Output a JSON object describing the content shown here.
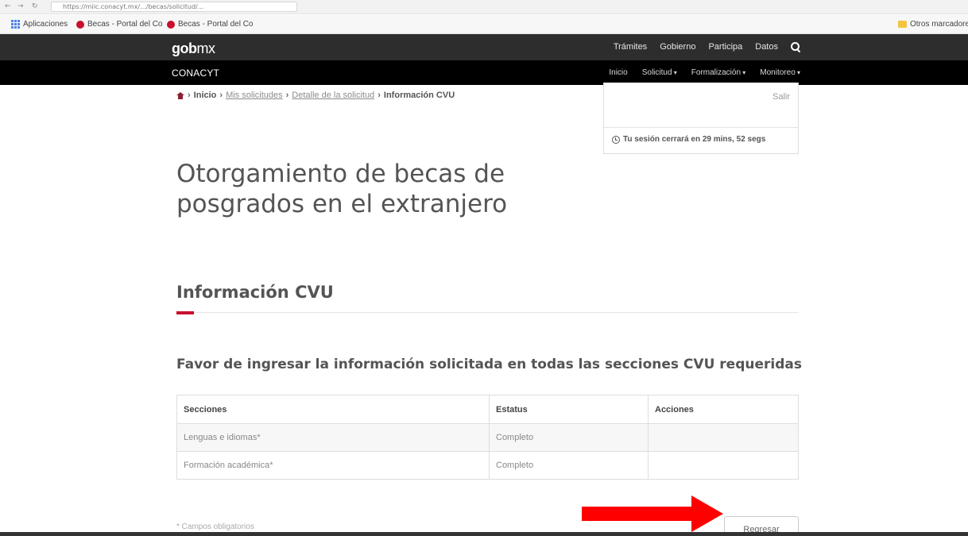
{
  "browser": {
    "url": "https://miic.conacyt.mx/.../becas/solicitud/...",
    "bookmarks": [
      {
        "label": "Aplicaciones",
        "icon": "apps-icon"
      },
      {
        "label": "Becas - Portal del Co",
        "icon": "conacyt-favicon"
      },
      {
        "label": "Becas - Portal del Co",
        "icon": "conacyt-favicon"
      }
    ],
    "other_bookmarks": "Otros marcadores"
  },
  "gob_header": {
    "logo_gob": "gob",
    "logo_mx": "mx",
    "links": [
      "Trámites",
      "Gobierno",
      "Participa",
      "Datos"
    ]
  },
  "conacyt_header": {
    "title": "CONACYT",
    "links": [
      "Inicio",
      "Solicitud",
      "Formalización",
      "Monitoreo"
    ]
  },
  "breadcrumb": {
    "items": [
      "Inicio",
      "Mis solicitudes",
      "Detalle de la solicitud",
      "Información CVU"
    ]
  },
  "session": {
    "logout": "Salir",
    "message": "Tu sesión cerrará en 29 mins, 52 segs"
  },
  "page": {
    "title": "Otorgamiento de becas de posgrados en el extranjero",
    "section_title": "Información CVU",
    "subtitle": "Favor de ingresar la información solicitada en todas las secciones CVU requeridas",
    "required_note": "* Campos obligatorios",
    "back_button": "Regresar"
  },
  "table": {
    "headers": [
      "Secciones",
      "Estatus",
      "Acciones"
    ],
    "rows": [
      [
        "Lenguas e idiomas*",
        "Completo",
        ""
      ],
      [
        "Formación académica*",
        "Completo",
        ""
      ]
    ]
  },
  "colors": {
    "accent": "#c8102e",
    "gob_bar": "#2d2d2d",
    "conacyt_bar": "#000000",
    "annotation_arrow": "#ff0000"
  }
}
